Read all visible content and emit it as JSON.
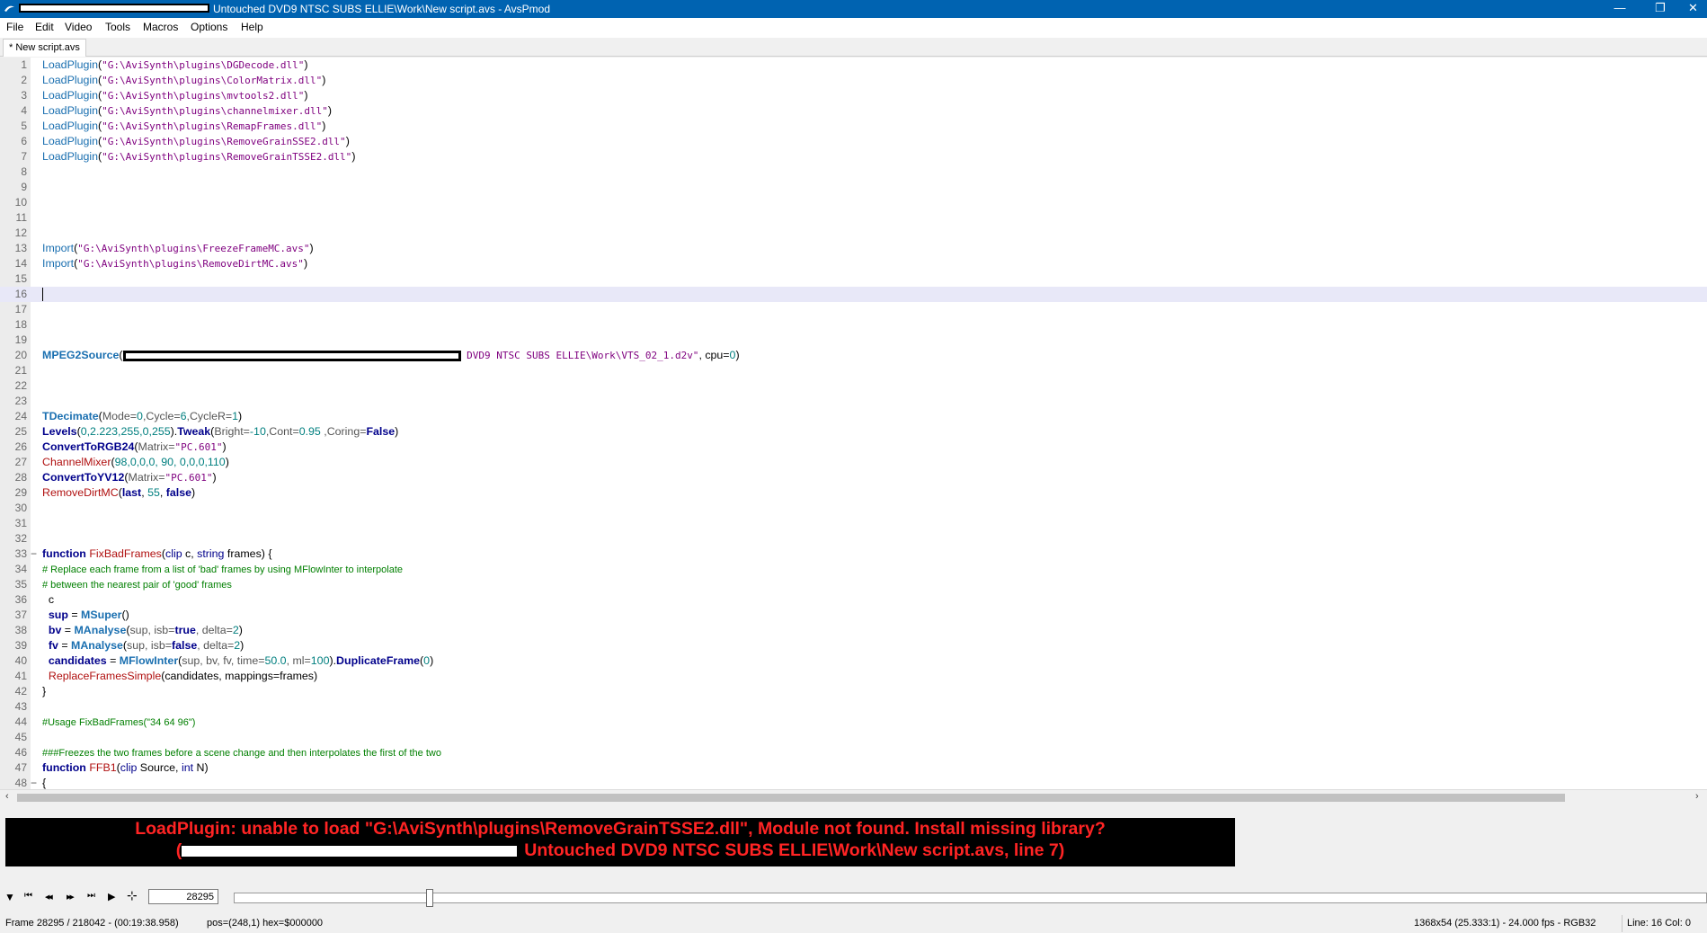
{
  "window": {
    "title": "Untouched DVD9 NTSC SUBS ELLIE\\Work\\New script.avs - AvsPmod",
    "minimize_label": "—",
    "restore_label": "❐",
    "close_label": "✕"
  },
  "menu": [
    "File",
    "Edit",
    "Video",
    "Tools",
    "Macros",
    "Options",
    "Help"
  ],
  "tab": {
    "label": "* New script.avs"
  },
  "code": {
    "line_numbers": [
      "1",
      "2",
      "3",
      "4",
      "5",
      "6",
      "7",
      "8",
      "9",
      "10",
      "11",
      "12",
      "13",
      "14",
      "15",
      "16",
      "17",
      "18",
      "19",
      "20",
      "21",
      "22",
      "23",
      "24",
      "25",
      "26",
      "27",
      "28",
      "29",
      "30",
      "31",
      "32",
      "33",
      "34",
      "35",
      "36",
      "37",
      "38",
      "39",
      "40",
      "41",
      "42",
      "43",
      "44",
      "45",
      "46",
      "47",
      "48"
    ],
    "l1": {
      "fn": "LoadPlugin",
      "p1": "(",
      "s": "\"G:\\AviSynth\\plugins\\DGDecode.dll\"",
      "p2": ")"
    },
    "l2": {
      "fn": "LoadPlugin",
      "p1": "(",
      "s": "\"G:\\AviSynth\\plugins\\ColorMatrix.dll\"",
      "p2": ")"
    },
    "l3": {
      "fn": "LoadPlugin",
      "p1": "(",
      "s": "\"G:\\AviSynth\\plugins\\mvtools2.dll\"",
      "p2": ")"
    },
    "l4": {
      "fn": "LoadPlugin",
      "p1": "(",
      "s": "\"G:\\AviSynth\\plugins\\channelmixer.dll\"",
      "p2": ")"
    },
    "l5": {
      "fn": "LoadPlugin",
      "p1": "(",
      "s": "\"G:\\AviSynth\\plugins\\RemapFrames.dll\"",
      "p2": ")"
    },
    "l6": {
      "fn": "LoadPlugin",
      "p1": "(",
      "s": "\"G:\\AviSynth\\plugins\\RemoveGrainSSE2.dll\"",
      "p2": ")"
    },
    "l7": {
      "fn": "LoadPlugin",
      "p1": "(",
      "s": "\"G:\\AviSynth\\plugins\\RemoveGrainTSSE2.dll\"",
      "p2": ")"
    },
    "l13": {
      "fn": "Import",
      "p1": "(",
      "s": "\"G:\\AviSynth\\plugins\\FreezeFrameMC.avs\"",
      "p2": ")"
    },
    "l14": {
      "fn": "Import",
      "p1": "(",
      "s": "\"G:\\AviSynth\\plugins\\RemoveDirtMC.avs\"",
      "p2": ")"
    },
    "l20": {
      "fn": "MPEG2Source",
      "p1": "(",
      "s": " DVD9 NTSC SUBS ELLIE\\Work\\VTS_02_1.d2v\"",
      "rest1": ", cpu=",
      "n": "0",
      "p2": ")"
    },
    "l24": {
      "fn": "TDecimate",
      "p1": "(",
      "a1": "Mode=",
      "n1": "0",
      "a2": ",Cycle=",
      "n2": "6",
      "a3": ",CycleR=",
      "n3": "1",
      "p2": ")"
    },
    "l25": {
      "fn": "Levels",
      "p1": "(",
      "n": "0,2.223,255,0,255",
      "p2": ").",
      "fn2": "Tweak",
      "p3": "(",
      "a1": "Bright=",
      "n1": "-10",
      "a2": ",Cont=",
      "n2": "0.95",
      "a3": " ,Coring=",
      "b": "False",
      "p4": ")"
    },
    "l26": {
      "fn": "ConvertToRGB24",
      "p1": "(",
      "a": "Matrix=",
      "s": "\"PC.601\"",
      "p2": ")"
    },
    "l27": {
      "fn": "ChannelMixer",
      "p1": "(",
      "n": "98,0,0,0, 90, 0,0,0,110",
      "p2": ")"
    },
    "l28": {
      "fn": "ConvertToYV12",
      "p1": "(",
      "a": "Matrix=",
      "s": "\"PC.601\"",
      "p2": ")"
    },
    "l29": {
      "fn": "RemoveDirtMC",
      "p1": "(",
      "k1": "last",
      "c1": ", ",
      "n": "55",
      "c2": ", ",
      "k2": "false",
      "p2": ")"
    },
    "l33": {
      "kw": "function",
      "name": " FixBadFrames",
      "p1": "(",
      "t1": "clip",
      "v1": " c, ",
      "t2": "string",
      "v2": " frames) {"
    },
    "l34": {
      "comment": "# Replace each frame from a list of 'bad' frames by using MFlowInter to interpolate"
    },
    "l35": {
      "comment": "# between the nearest pair of 'good' frames"
    },
    "l36": {
      "text": "  c"
    },
    "l37": {
      "v": "  sup",
      "eq": " = ",
      "fn": "MSuper",
      "p": "()"
    },
    "l38": {
      "v": "  bv",
      "eq": " = ",
      "fn": "MAnalyse",
      "p1": "(",
      "a1": "sup, isb=",
      "b": "true",
      "a2": ", delta=",
      "n": "2",
      "p2": ")"
    },
    "l39": {
      "v": "  fv",
      "eq": " = ",
      "fn": "MAnalyse",
      "p1": "(",
      "a1": "sup, isb=",
      "b": "false",
      "a2": ", delta=",
      "n": "2",
      "p2": ")"
    },
    "l40": {
      "v": "  candidates",
      "eq": " = ",
      "fn": "MFlowInter",
      "p1": "(",
      "a1": "sup, bv, fv, time=",
      "n1": "50.0",
      "a2": ", ml=",
      "n2": "100",
      "p2": ").",
      "fn2": "DuplicateFrame",
      "p3": "(",
      "n3": "0",
      "p4": ")"
    },
    "l41": {
      "pre": "  ",
      "fn": "ReplaceFramesSimple",
      "rest": "(candidates, mappings=frames)"
    },
    "l42": {
      "text": "}"
    },
    "l44": {
      "comment": "#Usage FixBadFrames(\"34 64 96\")"
    },
    "l46": {
      "comment": "###Freezes the two frames before a scene change and then interpolates the first of the two"
    },
    "l47": {
      "kw": "function",
      "name": " FFB1",
      "p1": "(",
      "t1": "clip",
      "v1": " Source, ",
      "t2": "int",
      "v2": " N)"
    },
    "l48": {
      "text": "{"
    },
    "fold33": "−",
    "fold48": "−"
  },
  "error": {
    "line1": "LoadPlugin: unable to load \"G:\\AviSynth\\plugins\\RemoveGrainTSSE2.dll\", Module not found.  Install missing library?",
    "line2_prefix": "(",
    "line2": "Untouched DVD9 NTSC SUBS ELLIE\\Work\\New script.avs, line 7)"
  },
  "playback": {
    "menu_icon": "▼",
    "first_icon": "⏮",
    "prev_icon": "◀◀",
    "next_icon": "▶▶",
    "last_icon": "⏭",
    "play_icon": "▶",
    "extra_icon": "⊹",
    "frame_value": "28295",
    "position_fraction": 0.1311
  },
  "status": {
    "frame": "Frame 28295 / 218042  -  (00:19:38.958)",
    "pos": "pos=(248,1)  hex=$000000",
    "video": "1368x54 (25.333:1)  -  24.000 fps  -  RGB32",
    "cursor": "Line: 16  Col: 0"
  },
  "scroll": {
    "left_arrow": "‹",
    "right_arrow": "›"
  }
}
